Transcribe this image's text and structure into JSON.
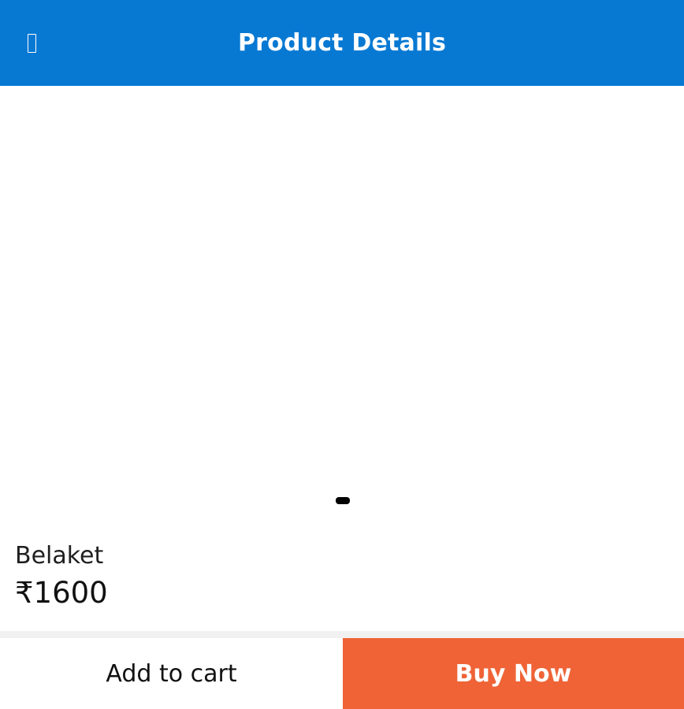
{
  "header": {
    "title": "Product Details",
    "back_icon": "back-icon",
    "background_color": "#0779d3"
  },
  "gallery": {
    "pagination_dots": 1,
    "active_dot": 1
  },
  "product": {
    "name": "Belaket",
    "price": "₹1600"
  },
  "actions": {
    "add_to_cart_label": "Add to cart",
    "buy_now_label": "Buy Now",
    "buy_now_color": "#ef6336"
  }
}
